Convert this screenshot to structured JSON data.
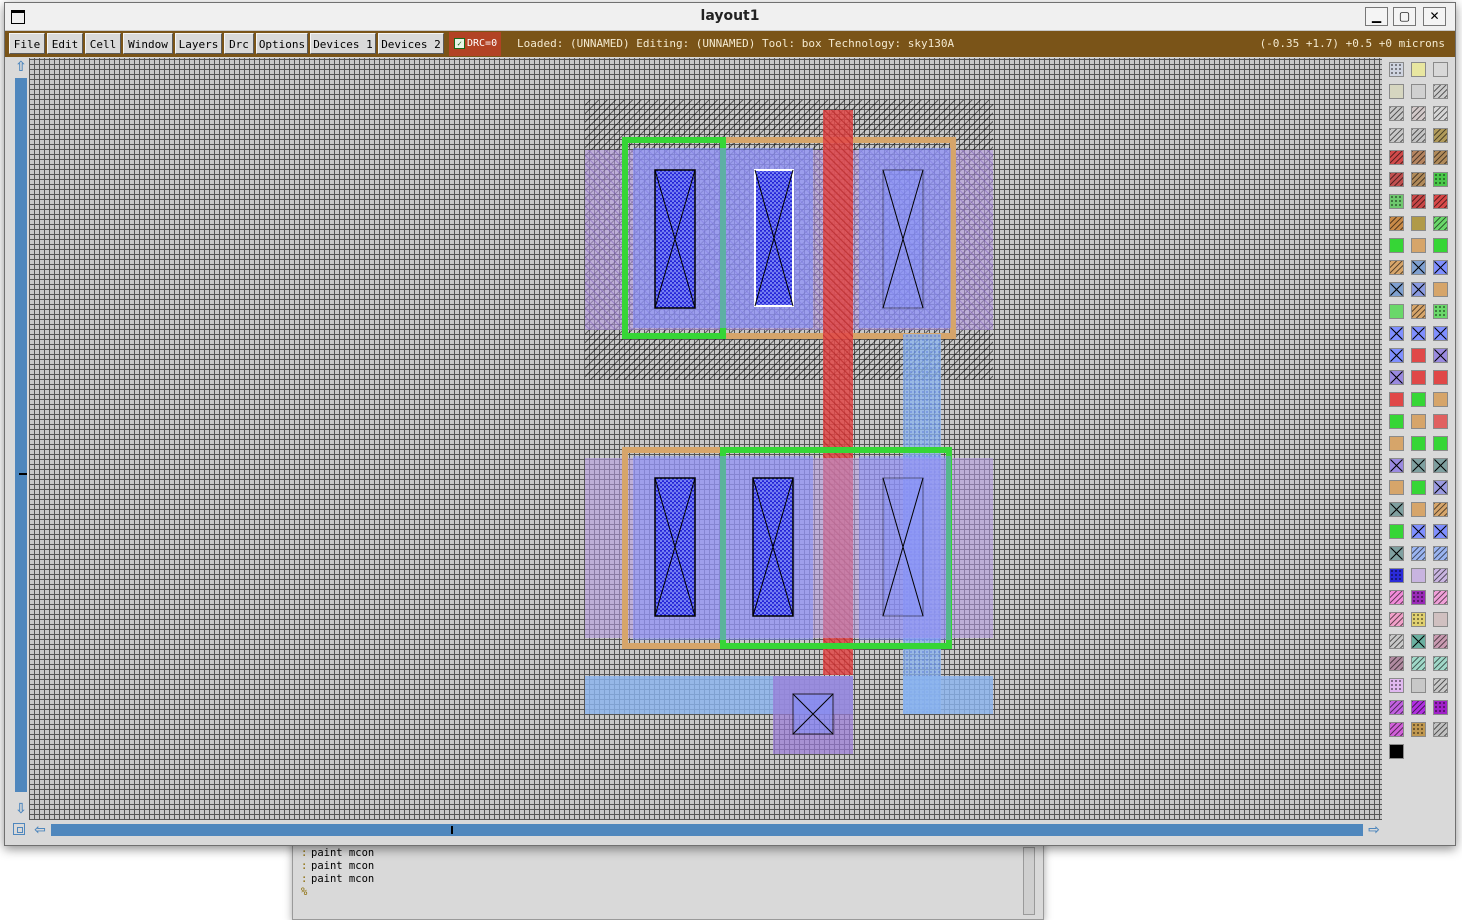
{
  "window": {
    "title": "layout1",
    "minimize_label": "▁",
    "maximize_label": "▢",
    "close_label": "✕"
  },
  "menu": [
    {
      "id": "file",
      "label": "File"
    },
    {
      "id": "edit",
      "label": "Edit"
    },
    {
      "id": "cell",
      "label": "Cell"
    },
    {
      "id": "window",
      "label": "Window"
    },
    {
      "id": "layers",
      "label": "Layers"
    },
    {
      "id": "drc",
      "label": "Drc"
    },
    {
      "id": "options",
      "label": "Options"
    },
    {
      "id": "devices1",
      "label": "Devices 1"
    },
    {
      "id": "devices2",
      "label": "Devices 2"
    }
  ],
  "drc_status": "DRC=0",
  "status_line": "Loaded: (UNNAMED) Editing: (UNNAMED) Tool: box  Technology: sky130A",
  "coordinates": "(-0.35 +1.7) +0.5 +0 microns",
  "console_lines": [
    "paint mcon",
    "paint mcon",
    "paint mcon"
  ],
  "layer_colors": {
    "diffusion_green": "#36d636",
    "nwell_orange": "#d6a56a",
    "poly_red": "#e04848",
    "li_blue": "#7f8fff",
    "metal1_lightblue": "#8ab4f0",
    "well_purple": "#b48ee6",
    "contact_blue": "#2020d0",
    "canvas_grey": "#c8c8c8",
    "menubar_brown": "#7a5418",
    "scrollbar_blue": "#4f87bd"
  }
}
